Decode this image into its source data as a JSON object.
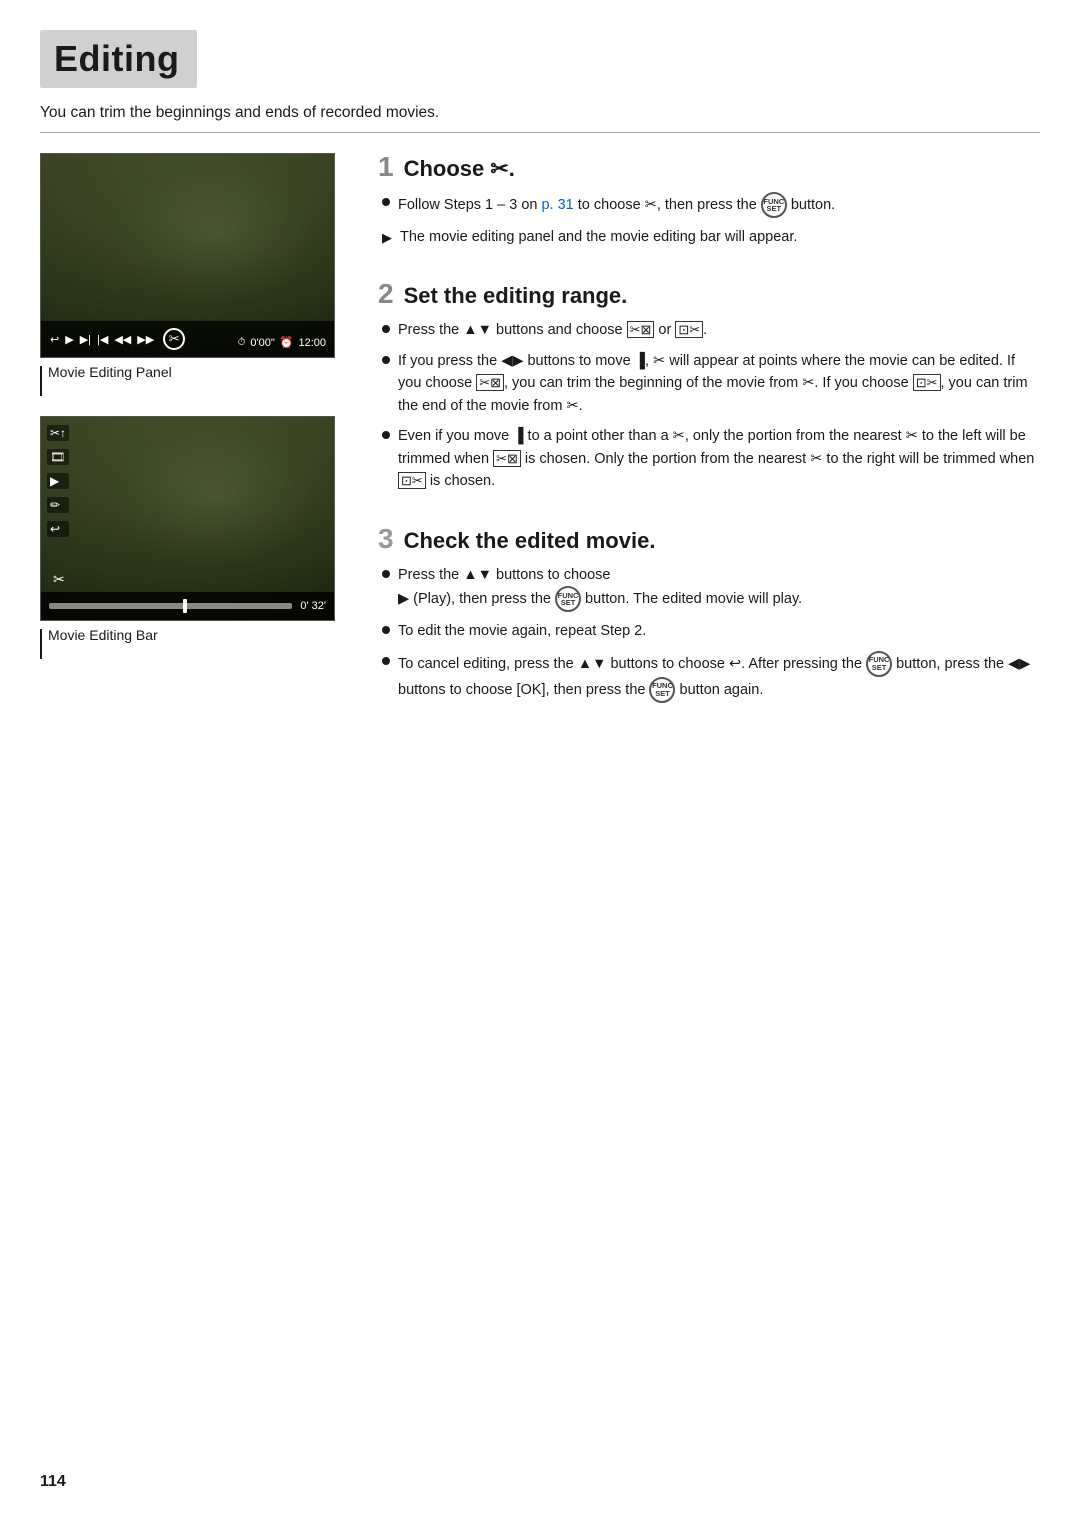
{
  "page": {
    "title": "Editing",
    "subtitle": "You can trim the beginnings and ends of recorded movies.",
    "page_number": "114"
  },
  "images": {
    "first_label": "Movie Editing Panel",
    "second_label": "Movie Editing Bar",
    "first_time": "0'00\"",
    "first_time2": "12:00",
    "second_time": "0' 32'"
  },
  "steps": [
    {
      "number": "1",
      "title": "Choose ✂.",
      "bullets": [
        {
          "type": "dot",
          "text": "Follow Steps 1 – 3 on p. 31 to choose ✂, then press the FUNC button."
        },
        {
          "type": "arrow",
          "text": "The movie editing panel and the movie editing bar will appear."
        }
      ]
    },
    {
      "number": "2",
      "title": "Set the editing range.",
      "bullets": [
        {
          "type": "dot",
          "text": "Press the ▲▼ buttons and choose ⊠ or ⊡."
        },
        {
          "type": "dot",
          "text": "If you press the ◀▶ buttons to move ▐, ✂ will appear at points where the movie can be edited. If you choose ⊠, you can trim the beginning of the movie from ✂. If you choose ⊡, you can trim the end of the movie from ✂."
        },
        {
          "type": "dot",
          "text": "Even if you move ▐ to a point other than a ✂, only the portion from the nearest ✂ to the left will be trimmed when ⊠ is chosen. Only the portion from the nearest ✂ to the right will be trimmed when ⊡ is chosen."
        }
      ]
    },
    {
      "number": "3",
      "title": "Check the edited movie.",
      "bullets": [
        {
          "type": "dot",
          "text": "Press the ▲▼ buttons to choose ▶ (Play), then press the FUNC button. The edited movie will play."
        },
        {
          "type": "dot",
          "text": "To edit the movie again, repeat Step 2."
        },
        {
          "type": "dot",
          "text": "To cancel editing, press the ▲▼ buttons to choose ↩. After pressing the FUNC button, press the ◀▶ buttons to choose [OK], then press the FUNC button again."
        }
      ]
    }
  ]
}
